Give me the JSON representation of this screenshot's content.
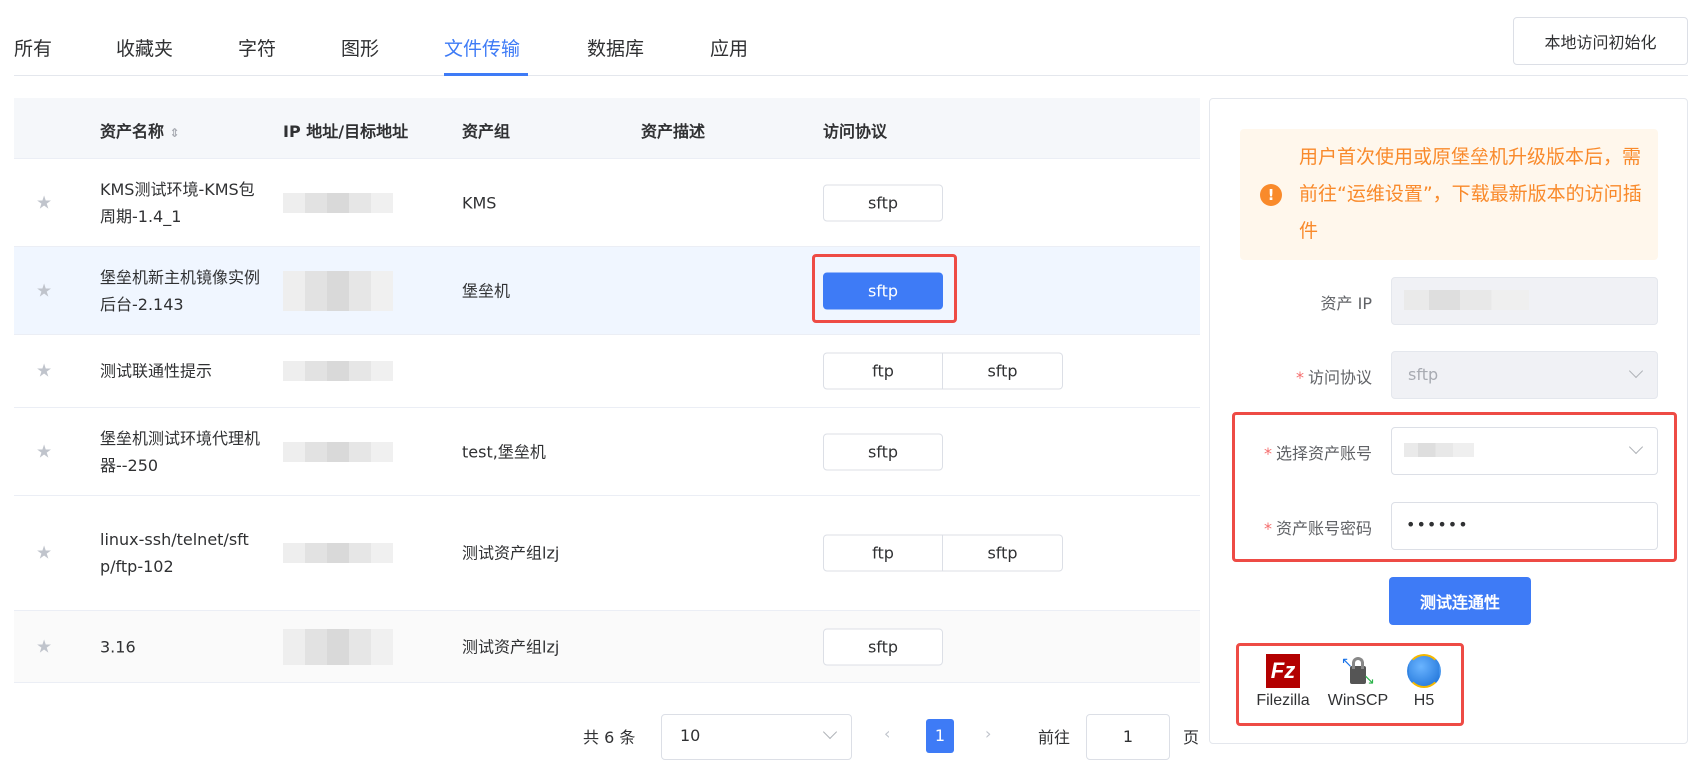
{
  "tabs": [
    {
      "label": "所有"
    },
    {
      "label": "收藏夹"
    },
    {
      "label": "字符"
    },
    {
      "label": "图形"
    },
    {
      "label": "文件传输",
      "active": true
    },
    {
      "label": "数据库"
    },
    {
      "label": "应用"
    }
  ],
  "init_button": "本地访问初始化",
  "table": {
    "headers": [
      "资产名称",
      "IP 地址/目标地址",
      "资产组",
      "资产描述",
      "访问协议"
    ],
    "rows": [
      {
        "name": "KMS测试环境-KMS包周期-1.4_1",
        "group": "KMS",
        "protocols": [
          "sftp"
        ]
      },
      {
        "name": "堡垒机新主机镜像实例后台-2.143",
        "group": "堡垒机",
        "protocols": [
          "sftp"
        ],
        "selected": true
      },
      {
        "name": "测试联通性提示",
        "group": "",
        "protocols": [
          "ftp",
          "sftp"
        ]
      },
      {
        "name": "堡垒机测试环境代理机器--250",
        "group": "test,堡垒机",
        "protocols": [
          "sftp"
        ]
      },
      {
        "name": "linux-ssh/telnet/sftp/ftp-102",
        "group": "测试资产组lzj",
        "protocols": [
          "ftp",
          "sftp"
        ]
      },
      {
        "name": "3.16",
        "group": "测试资产组lzj",
        "protocols": [
          "sftp"
        ]
      }
    ]
  },
  "panel": {
    "alert": "用户首次使用或原堡垒机升级版本后，需前往“运维设置”，下载最新版本的访问插件",
    "asset_ip_label": "资产 IP",
    "protocol_label": "访问协议",
    "protocol_value": "sftp",
    "account_label": "选择资产账号",
    "password_label": "资产账号密码",
    "password_value": "••••••",
    "required_mark": "*",
    "test_button": "测试连通性",
    "clients": [
      {
        "label": "Filezilla"
      },
      {
        "label": "WinSCP"
      },
      {
        "label": "H5"
      }
    ]
  },
  "pagination": {
    "total": "共 6 条",
    "page_size": "10",
    "current_page": "1",
    "goto_label": "前往",
    "goto_value": "1",
    "page_suffix": "页"
  },
  "colors": {
    "accent": "#3e7bf6",
    "highlight": "#ee4b45",
    "warning": "#f98a2b"
  }
}
